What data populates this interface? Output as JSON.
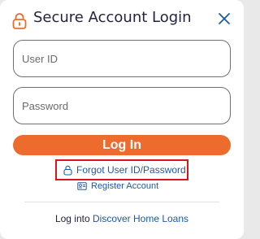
{
  "dialog": {
    "title": "Secure Account Login",
    "title_icon": "lock-icon",
    "close_icon": "close-icon"
  },
  "form": {
    "user_id_placeholder": "User ID",
    "password_placeholder": "Password",
    "login_label": "Log In"
  },
  "links": {
    "forgot_label": "Forgot User ID/Password",
    "forgot_icon": "lock-icon",
    "register_label": "Register Account",
    "register_icon": "id-card-icon"
  },
  "footer": {
    "prefix": "Log into",
    "link_label": "Discover Home Loans"
  },
  "colors": {
    "accent": "#ec6b2d",
    "link": "#1c5aa6",
    "highlight_border": "#d8151b"
  }
}
